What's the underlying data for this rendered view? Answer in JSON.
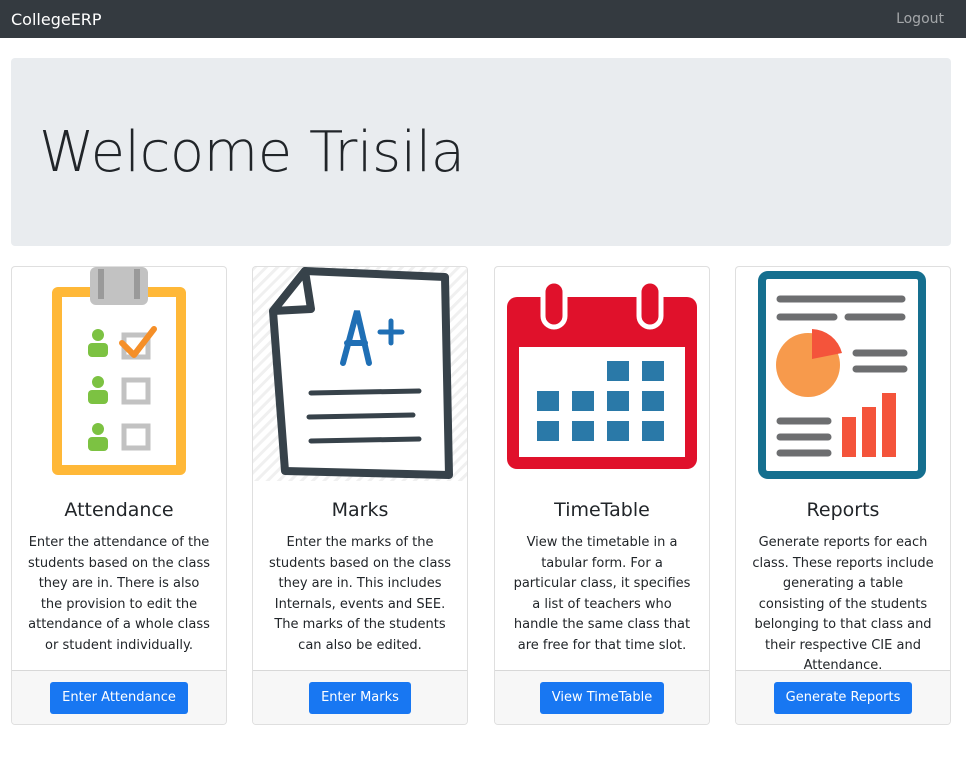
{
  "navbar": {
    "brand": "CollegeERP",
    "logout": "Logout"
  },
  "welcome": {
    "heading": "Welcome Trisila"
  },
  "cards": [
    {
      "title": "Attendance",
      "text": "Enter the attendance of the students based on the class they are in. There is also the provision to edit the attendance of a whole class or student individually.",
      "button": "Enter Attendance",
      "icon": "clipboard-checklist-icon"
    },
    {
      "title": "Marks",
      "text": "Enter the marks of the students based on the class they are in. This includes Internals, events and SEE. The marks of the students can also be edited.",
      "button": "Enter Marks",
      "icon": "graded-paper-icon"
    },
    {
      "title": "TimeTable",
      "text": "View the timetable in a tabular form. For a particular class, it specifies a list of teachers who handle the same class that are free for that time slot.",
      "button": "View TimeTable",
      "icon": "calendar-icon"
    },
    {
      "title": "Reports",
      "text": "Generate reports for each class. These reports include generating a table consisting of the students belonging to that class and their respective CIE and Attendance.",
      "button": "Generate Reports",
      "icon": "report-chart-icon"
    }
  ],
  "colors": {
    "navbar": "#343a40",
    "jumbotron": "#e9ecef",
    "button": "#1877f2"
  }
}
